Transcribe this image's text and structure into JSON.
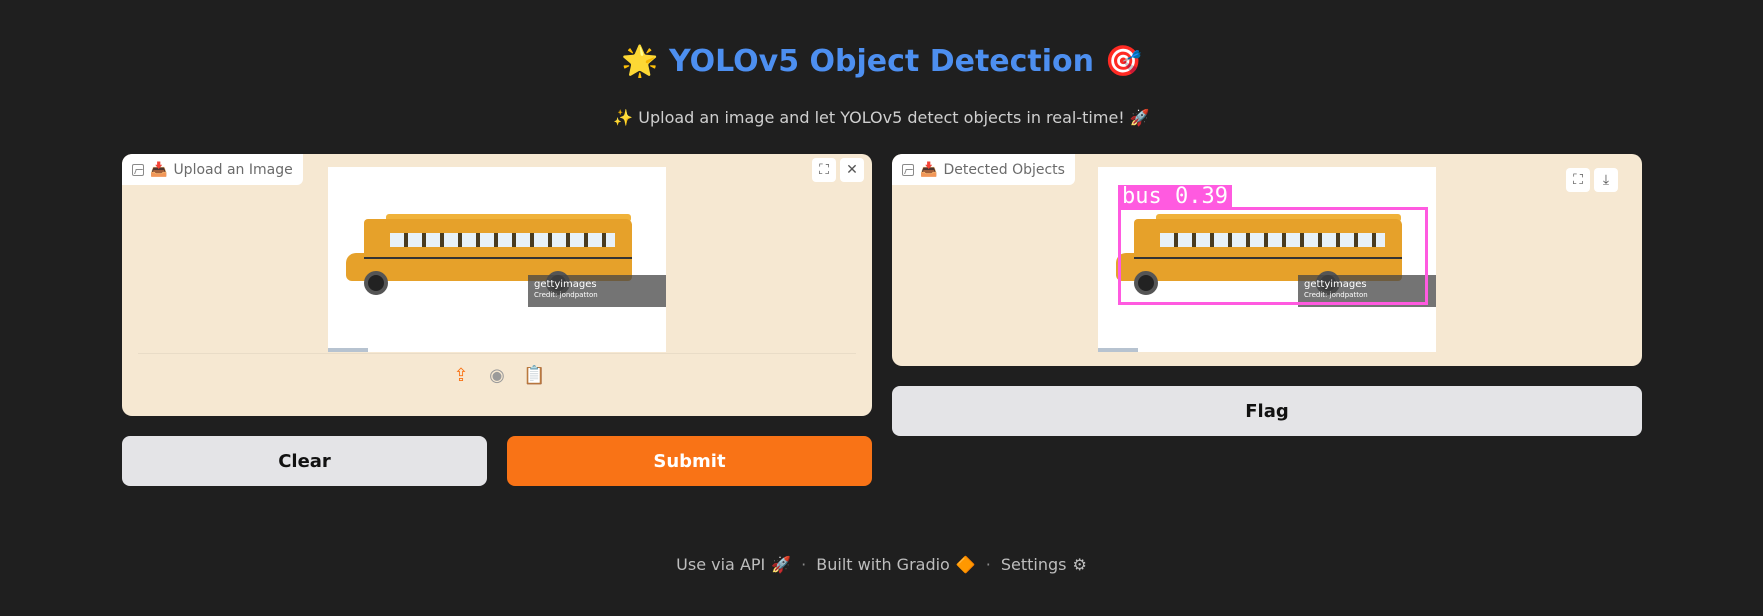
{
  "header": {
    "title": "🌟 YOLOv5 Object Detection 🎯",
    "subtitle": "✨ Upload an image and let YOLOv5 detect objects in real-time! 🚀"
  },
  "input_panel": {
    "label_emoji": "📥",
    "label": "Upload an Image",
    "tools": {
      "fullscreen_icon": "⛶",
      "close_icon": "✕"
    },
    "watermark": "gettyimages",
    "watermark_credit": "Credit: jondpatton",
    "source_icons": {
      "upload": "⇪",
      "webcam": "◉",
      "clipboard": "📋"
    }
  },
  "output_panel": {
    "label_emoji": "📥",
    "label": "Detected Objects",
    "tools": {
      "fullscreen_icon": "⛶",
      "download_icon": "⤓"
    },
    "detection_label": "bus 0.39",
    "watermark": "gettyimages",
    "watermark_credit": "Credit: jondpatton"
  },
  "buttons": {
    "clear": "Clear",
    "submit": "Submit",
    "flag": "Flag"
  },
  "footer": {
    "api": "Use via API",
    "api_icon": "🚀",
    "sep": "·",
    "built": "Built with Gradio",
    "built_icon": "🔶",
    "settings": "Settings",
    "settings_icon": "⚙"
  },
  "colors": {
    "accent": "#f97316",
    "title": "#4d8ff0",
    "detection_box": "#ff5ae0"
  }
}
